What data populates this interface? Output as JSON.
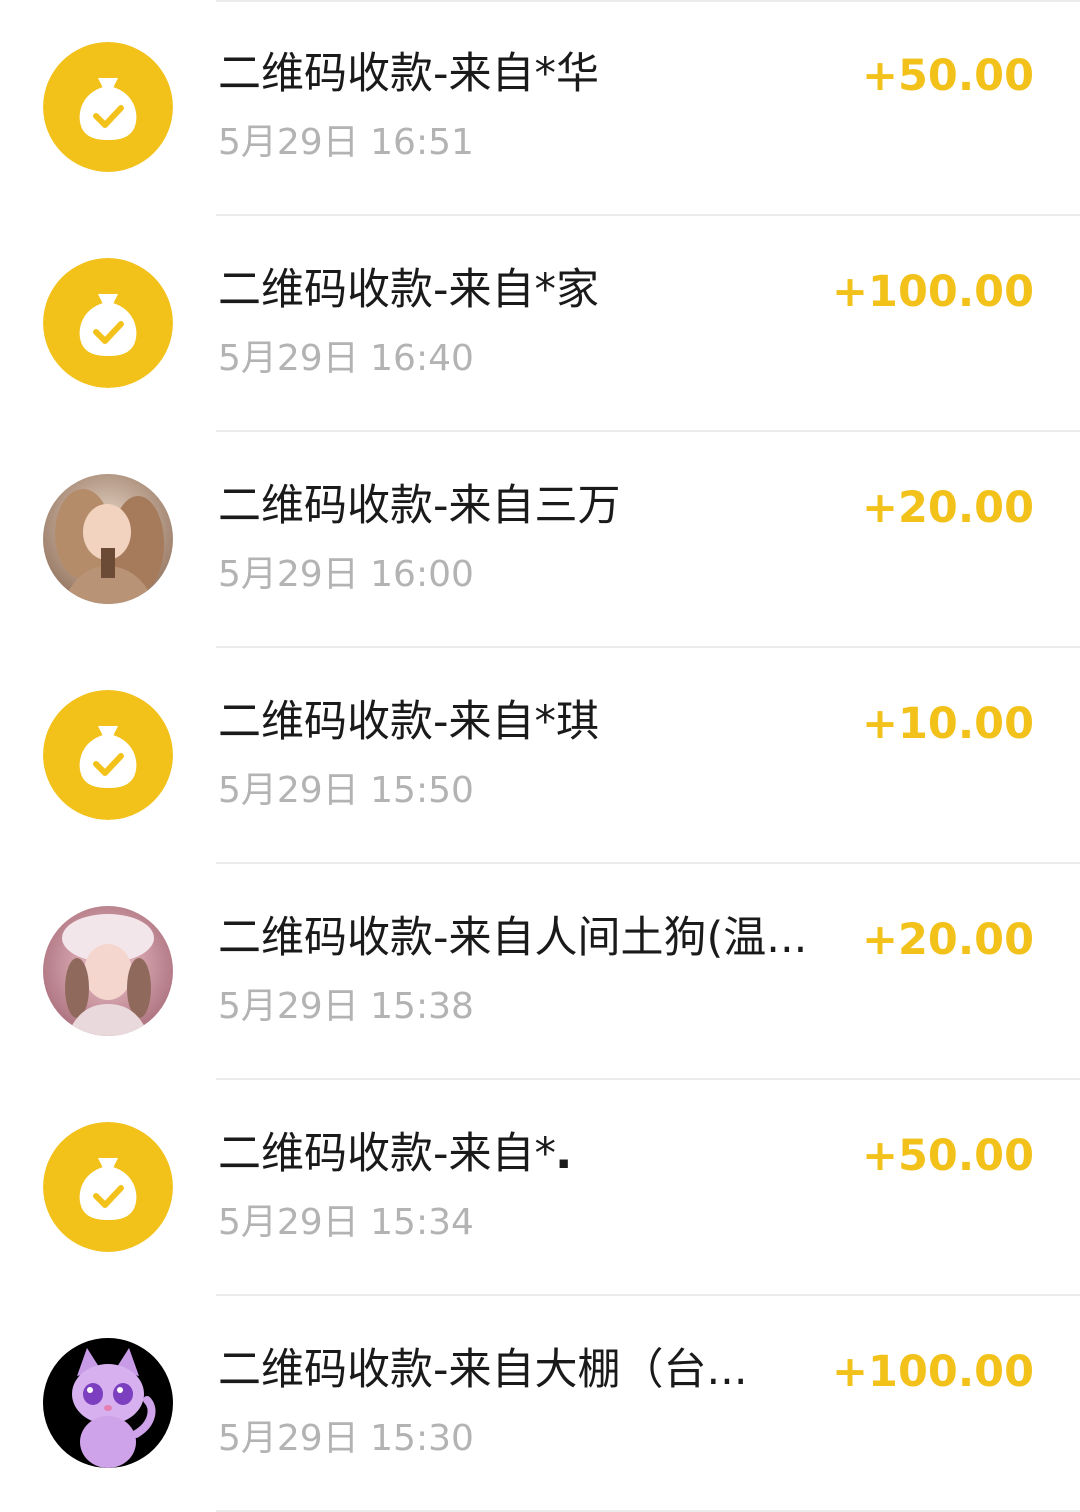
{
  "accent_color": "#f2c21b",
  "transactions": [
    {
      "title": "二维码收款-来自*华",
      "time": "5月29日 16:51",
      "amount": "+50.00",
      "avatar": "money-bag-icon"
    },
    {
      "title": "二维码收款-来自*家",
      "time": "5月29日 16:40",
      "amount": "+100.00",
      "avatar": "money-bag-icon"
    },
    {
      "title": "二维码收款-来自三万",
      "time": "5月29日 16:00",
      "amount": "+20.00",
      "avatar": "user-photo"
    },
    {
      "title": "二维码收款-来自*琪",
      "time": "5月29日 15:50",
      "amount": "+10.00",
      "avatar": "money-bag-icon"
    },
    {
      "title": "二维码收款-来自人间土狗(温...",
      "time": "5月29日 15:38",
      "amount": "+20.00",
      "avatar": "user-photo"
    },
    {
      "title": "二维码收款-来自*𝅇",
      "time": "5月29日 15:34",
      "amount": "+50.00",
      "avatar": "money-bag-icon"
    },
    {
      "title": "二维码收款-来自大棚（台...",
      "time": "5月29日 15:30",
      "amount": "+100.00",
      "avatar": "cartoon-cat-avatar"
    }
  ]
}
